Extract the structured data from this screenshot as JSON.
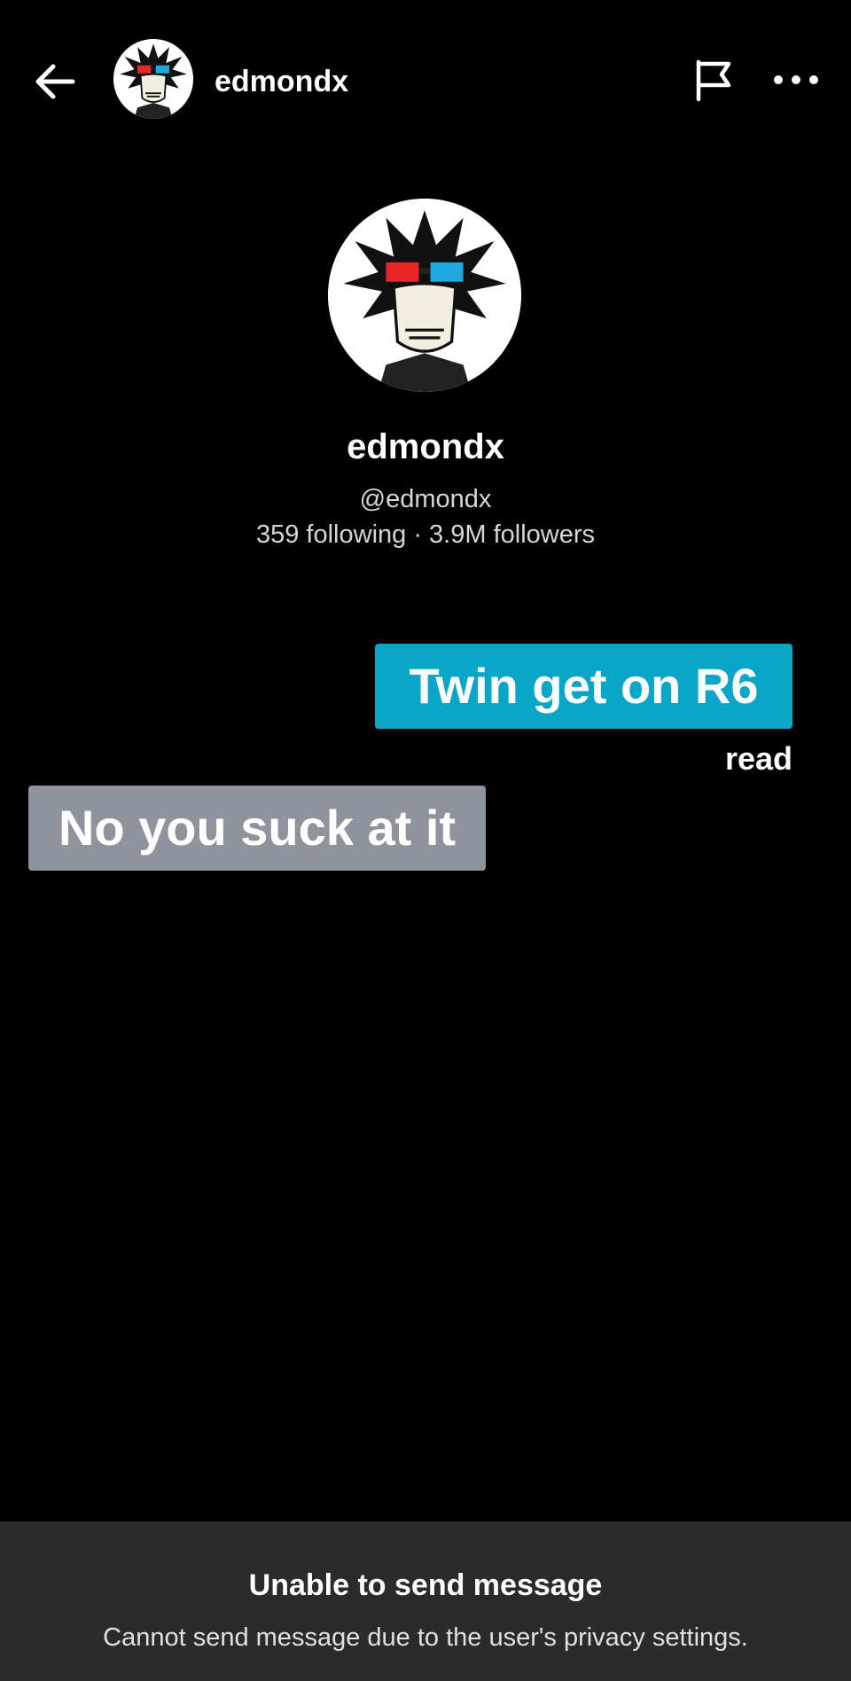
{
  "header": {
    "username": "edmondx",
    "icons": {
      "back": "arrow-left-icon",
      "flag": "flag-icon",
      "more": "more-horizontal-icon"
    }
  },
  "profile": {
    "display_name": "edmondx",
    "handle": "@edmondx",
    "stats": "359 following · 3.9M followers"
  },
  "messages": [
    {
      "sender": "me",
      "text": "Twin get on R6",
      "color": "#0aa5c7"
    },
    {
      "sender": "them",
      "text": "No you suck at it",
      "color": "#8f949c"
    }
  ],
  "read_status": "read",
  "footer": {
    "title": "Unable to send message",
    "description": "Cannot send message due to the user's privacy settings."
  },
  "colors": {
    "background": "#000000",
    "footer_background": "#2b2b2b",
    "sent_bubble": "#0aa5c7",
    "received_bubble": "#8f949c"
  }
}
